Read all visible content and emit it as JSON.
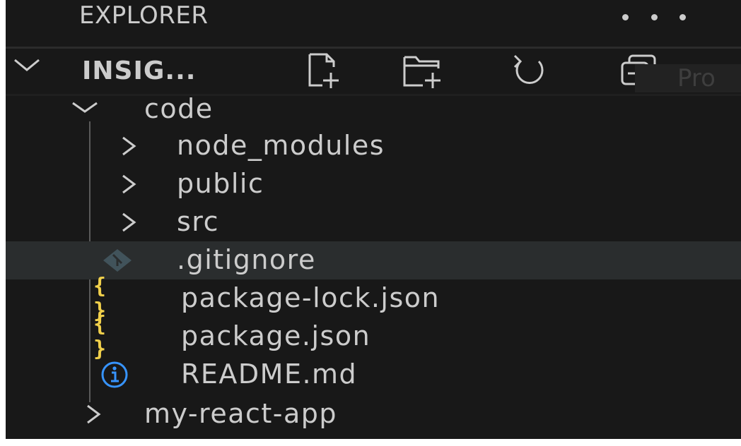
{
  "explorer": {
    "title": "EXPLORER"
  },
  "workspace": {
    "title": "INSIG...",
    "ghost_text": "Pro",
    "actions": [
      "new-file-icon",
      "new-folder-icon",
      "refresh-icon",
      "collapse-all-icon"
    ]
  },
  "tree": {
    "code_folder": "code",
    "items": [
      {
        "label": "node_modules",
        "type": "folder",
        "expanded": false
      },
      {
        "label": "public",
        "type": "folder",
        "expanded": false
      },
      {
        "label": "src",
        "type": "folder",
        "expanded": false
      },
      {
        "label": ".gitignore",
        "type": "file",
        "icon": "git-icon",
        "selected": true
      },
      {
        "label": "package-lock.json",
        "type": "file",
        "icon": "json-icon"
      },
      {
        "label": "package.json",
        "type": "file",
        "icon": "json-icon"
      },
      {
        "label": "README.md",
        "type": "file",
        "icon": "info-icon"
      }
    ],
    "sibling_folder": "my-react-app"
  },
  "colors": {
    "background": "#181818",
    "text": "#cccccc",
    "selected_row": "#2a2d2e",
    "json_icon": "#f1d04b",
    "info_icon": "#3794ff",
    "git_icon": "#41535b"
  },
  "icons": {
    "json": "{ }"
  }
}
